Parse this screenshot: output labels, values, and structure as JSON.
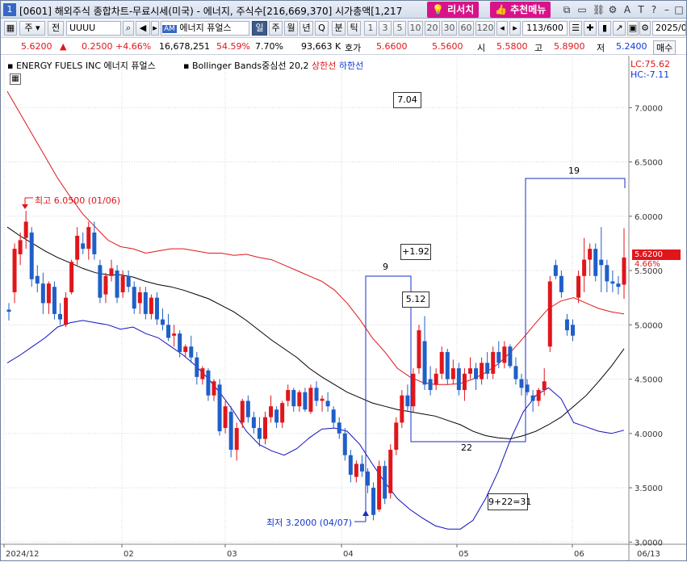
{
  "title": {
    "window_number": "1",
    "text": "[0601] 해외주식 종합차트-무료시세(미국) - 에너지, 주식수[216,669,370] 시가총액[1,217",
    "research_button": "리서치",
    "recommend_button": "추천메뉴",
    "icons": [
      "window-icon",
      "restore-icon",
      "link-icon",
      "settings-icon",
      "font-icon",
      "text-icon",
      "help-icon",
      "minimize-icon",
      "maximize-icon",
      "close-icon"
    ],
    "icon_glyphs": [
      "⧉",
      "▭",
      "⛓",
      "⚙",
      "A",
      "T",
      "?",
      "–",
      "□",
      "✕"
    ]
  },
  "toolbar": {
    "market_type": "주",
    "price_type": "전",
    "symbol": "UUUU",
    "am_badge": "AM",
    "stock_name": "에너지 퓨얼스",
    "periods": [
      "일",
      "주",
      "월",
      "년",
      "Q",
      "분",
      "틱"
    ],
    "selected_period": "일",
    "intervals": [
      "1",
      "3",
      "5",
      "10",
      "20",
      "30",
      "60",
      "120"
    ],
    "count": "113/600",
    "date": "2025/0"
  },
  "quote": {
    "price": "5.6200",
    "arrow": "▲",
    "change": "0.2500",
    "change_pct": "+4.66%",
    "volume": "16,678,251",
    "vol_ratio": "54.59%",
    "turnover": "7.70%",
    "amount": "93,663 K",
    "bid_label": "호가",
    "bid": "5.6600",
    "ask": "5.5600",
    "open_label": "시",
    "open": "5.5800",
    "high_label": "고",
    "high": "5.8900",
    "low_label": "저",
    "low": "5.2400",
    "trade_tab": "매수"
  },
  "legend": {
    "stock": "ENERGY FUELS INC  에너지 퓨얼스",
    "indicator": "Bollinger Bands중심선 20,2",
    "upper": "상한선",
    "lower": "하한선",
    "lc": "LC:75.62",
    "hc": "HC:-7.11"
  },
  "annotations": {
    "high_note": "최고 6.0500 (01/06)",
    "low_note": "최저 3.2000 (04/07)",
    "box_704": "7.04",
    "box_192": "+1.92",
    "box_512": "5.12",
    "box_sum": "9+22=31",
    "n9": "9",
    "n19": "19",
    "n22": "22"
  },
  "price_tag": {
    "price": "5.6200",
    "pct": "4.66%"
  },
  "colors": {
    "up": "#e0161b",
    "down": "#1f5fc8",
    "upper_band": "#e0161b",
    "lower_band": "#1010c0",
    "mid_band": "#000000"
  },
  "chart_data": {
    "type": "candlestick",
    "title": "ENERGY FUELS INC  에너지 퓨얼스",
    "x_ticks": [
      "2024/12",
      "02",
      "03",
      "04",
      "05",
      "06",
      "06/13"
    ],
    "y_ticks": [
      "7.0000",
      "6.5000",
      "6.0000",
      "5.5000",
      "5.0000",
      "4.5000",
      "4.0000",
      "3.5000",
      "3.0000"
    ],
    "ylim": [
      2.92,
      7.48
    ],
    "candles": [
      {
        "o": 5.14,
        "h": 5.2,
        "l": 5.04,
        "c": 5.12
      },
      {
        "o": 5.3,
        "h": 5.75,
        "l": 5.2,
        "c": 5.7
      },
      {
        "o": 5.65,
        "h": 5.85,
        "l": 5.55,
        "c": 5.78
      },
      {
        "o": 5.8,
        "h": 6.05,
        "l": 5.7,
        "c": 5.95
      },
      {
        "o": 5.85,
        "h": 5.9,
        "l": 5.35,
        "c": 5.42
      },
      {
        "o": 5.45,
        "h": 5.55,
        "l": 5.3,
        "c": 5.38
      },
      {
        "o": 5.38,
        "h": 5.48,
        "l": 5.1,
        "c": 5.2
      },
      {
        "o": 5.2,
        "h": 5.4,
        "l": 5.1,
        "c": 5.38
      },
      {
        "o": 5.35,
        "h": 5.4,
        "l": 5.05,
        "c": 5.1
      },
      {
        "o": 5.1,
        "h": 5.2,
        "l": 5.0,
        "c": 5.05
      },
      {
        "o": 5.0,
        "h": 5.3,
        "l": 4.98,
        "c": 5.25
      },
      {
        "o": 5.3,
        "h": 5.6,
        "l": 5.28,
        "c": 5.58
      },
      {
        "o": 5.6,
        "h": 5.9,
        "l": 5.55,
        "c": 5.82
      },
      {
        "o": 5.75,
        "h": 5.85,
        "l": 5.65,
        "c": 5.7
      },
      {
        "o": 5.7,
        "h": 5.95,
        "l": 5.6,
        "c": 5.9
      },
      {
        "o": 5.85,
        "h": 5.95,
        "l": 5.6,
        "c": 5.65
      },
      {
        "o": 5.55,
        "h": 5.6,
        "l": 5.2,
        "c": 5.25
      },
      {
        "o": 5.28,
        "h": 5.48,
        "l": 5.2,
        "c": 5.45
      },
      {
        "o": 5.45,
        "h": 5.6,
        "l": 5.4,
        "c": 5.52
      },
      {
        "o": 5.5,
        "h": 5.55,
        "l": 5.2,
        "c": 5.25
      },
      {
        "o": 5.3,
        "h": 5.5,
        "l": 5.25,
        "c": 5.45
      },
      {
        "o": 5.45,
        "h": 5.5,
        "l": 5.3,
        "c": 5.35
      },
      {
        "o": 5.35,
        "h": 5.4,
        "l": 5.1,
        "c": 5.15
      },
      {
        "o": 5.2,
        "h": 5.35,
        "l": 5.1,
        "c": 5.3
      },
      {
        "o": 5.3,
        "h": 5.35,
        "l": 5.05,
        "c": 5.1
      },
      {
        "o": 5.1,
        "h": 5.28,
        "l": 5.05,
        "c": 5.25
      },
      {
        "o": 5.25,
        "h": 5.3,
        "l": 5.0,
        "c": 5.05
      },
      {
        "o": 5.05,
        "h": 5.15,
        "l": 4.95,
        "c": 5.0
      },
      {
        "o": 5.0,
        "h": 5.1,
        "l": 4.85,
        "c": 4.88
      },
      {
        "o": 4.9,
        "h": 5.0,
        "l": 4.8,
        "c": 4.92
      },
      {
        "o": 4.92,
        "h": 4.95,
        "l": 4.7,
        "c": 4.75
      },
      {
        "o": 4.75,
        "h": 4.82,
        "l": 4.7,
        "c": 4.8
      },
      {
        "o": 4.8,
        "h": 4.9,
        "l": 4.65,
        "c": 4.7
      },
      {
        "o": 4.7,
        "h": 4.75,
        "l": 4.45,
        "c": 4.52
      },
      {
        "o": 4.5,
        "h": 4.62,
        "l": 4.45,
        "c": 4.6
      },
      {
        "o": 4.58,
        "h": 4.6,
        "l": 4.3,
        "c": 4.35
      },
      {
        "o": 4.35,
        "h": 4.5,
        "l": 4.3,
        "c": 4.48
      },
      {
        "o": 4.45,
        "h": 4.5,
        "l": 3.98,
        "c": 4.02
      },
      {
        "o": 4.05,
        "h": 4.3,
        "l": 4.0,
        "c": 4.25
      },
      {
        "o": 4.2,
        "h": 4.25,
        "l": 3.78,
        "c": 3.85
      },
      {
        "o": 3.85,
        "h": 4.1,
        "l": 3.75,
        "c": 4.05
      },
      {
        "o": 4.1,
        "h": 4.32,
        "l": 4.05,
        "c": 4.3
      },
      {
        "o": 4.3,
        "h": 4.35,
        "l": 4.1,
        "c": 4.15
      },
      {
        "o": 4.15,
        "h": 4.2,
        "l": 4.0,
        "c": 4.05
      },
      {
        "o": 4.05,
        "h": 4.15,
        "l": 3.88,
        "c": 3.95
      },
      {
        "o": 3.95,
        "h": 4.2,
        "l": 3.9,
        "c": 4.15
      },
      {
        "o": 4.15,
        "h": 4.35,
        "l": 4.1,
        "c": 4.25
      },
      {
        "o": 4.22,
        "h": 4.25,
        "l": 4.05,
        "c": 4.1
      },
      {
        "o": 4.1,
        "h": 4.3,
        "l": 4.05,
        "c": 4.28
      },
      {
        "o": 4.3,
        "h": 4.45,
        "l": 4.25,
        "c": 4.4
      },
      {
        "o": 4.4,
        "h": 4.42,
        "l": 4.2,
        "c": 4.25
      },
      {
        "o": 4.25,
        "h": 4.4,
        "l": 4.2,
        "c": 4.38
      },
      {
        "o": 4.38,
        "h": 4.42,
        "l": 4.2,
        "c": 4.22
      },
      {
        "o": 4.2,
        "h": 4.45,
        "l": 4.18,
        "c": 4.42
      },
      {
        "o": 4.42,
        "h": 4.48,
        "l": 4.25,
        "c": 4.3
      },
      {
        "o": 4.3,
        "h": 4.35,
        "l": 4.2,
        "c": 4.32
      },
      {
        "o": 4.3,
        "h": 4.38,
        "l": 4.2,
        "c": 4.25
      },
      {
        "o": 4.22,
        "h": 4.25,
        "l": 4.05,
        "c": 4.1
      },
      {
        "o": 4.1,
        "h": 4.15,
        "l": 3.95,
        "c": 4.0
      },
      {
        "o": 4.0,
        "h": 4.05,
        "l": 3.75,
        "c": 3.8
      },
      {
        "o": 3.8,
        "h": 3.85,
        "l": 3.55,
        "c": 3.62
      },
      {
        "o": 3.6,
        "h": 3.75,
        "l": 3.55,
        "c": 3.72
      },
      {
        "o": 3.72,
        "h": 3.8,
        "l": 3.6,
        "c": 3.65
      },
      {
        "o": 3.65,
        "h": 3.68,
        "l": 3.45,
        "c": 3.52
      },
      {
        "o": 3.5,
        "h": 3.55,
        "l": 3.2,
        "c": 3.25
      },
      {
        "o": 3.3,
        "h": 3.75,
        "l": 3.28,
        "c": 3.7
      },
      {
        "o": 3.7,
        "h": 3.75,
        "l": 3.35,
        "c": 3.4
      },
      {
        "o": 3.45,
        "h": 3.9,
        "l": 3.4,
        "c": 3.85
      },
      {
        "o": 3.85,
        "h": 4.15,
        "l": 3.8,
        "c": 4.1
      },
      {
        "o": 4.1,
        "h": 4.4,
        "l": 4.05,
        "c": 4.35
      },
      {
        "o": 4.35,
        "h": 4.45,
        "l": 4.2,
        "c": 4.25
      },
      {
        "o": 4.25,
        "h": 4.6,
        "l": 4.2,
        "c": 4.55
      },
      {
        "o": 4.6,
        "h": 5.0,
        "l": 4.55,
        "c": 4.95
      },
      {
        "o": 4.85,
        "h": 5.08,
        "l": 4.4,
        "c": 4.45
      },
      {
        "o": 4.5,
        "h": 4.62,
        "l": 4.35,
        "c": 4.4
      },
      {
        "o": 4.45,
        "h": 4.6,
        "l": 4.4,
        "c": 4.55
      },
      {
        "o": 4.55,
        "h": 4.8,
        "l": 4.5,
        "c": 4.75
      },
      {
        "o": 4.75,
        "h": 4.78,
        "l": 4.45,
        "c": 4.5
      },
      {
        "o": 4.5,
        "h": 4.68,
        "l": 4.45,
        "c": 4.6
      },
      {
        "o": 4.6,
        "h": 4.65,
        "l": 4.35,
        "c": 4.4
      },
      {
        "o": 4.4,
        "h": 4.6,
        "l": 4.3,
        "c": 4.55
      },
      {
        "o": 4.55,
        "h": 4.7,
        "l": 4.5,
        "c": 4.6
      },
      {
        "o": 4.6,
        "h": 4.65,
        "l": 4.4,
        "c": 4.5
      },
      {
        "o": 4.5,
        "h": 4.7,
        "l": 4.45,
        "c": 4.65
      },
      {
        "o": 4.65,
        "h": 4.75,
        "l": 4.5,
        "c": 4.55
      },
      {
        "o": 4.55,
        "h": 4.8,
        "l": 4.5,
        "c": 4.75
      },
      {
        "o": 4.75,
        "h": 4.85,
        "l": 4.6,
        "c": 4.65
      },
      {
        "o": 4.65,
        "h": 4.85,
        "l": 4.6,
        "c": 4.8
      },
      {
        "o": 4.8,
        "h": 4.82,
        "l": 4.6,
        "c": 4.62
      },
      {
        "o": 4.62,
        "h": 4.7,
        "l": 4.45,
        "c": 4.5
      },
      {
        "o": 4.5,
        "h": 4.55,
        "l": 4.35,
        "c": 4.42
      },
      {
        "o": 4.45,
        "h": 4.5,
        "l": 4.35,
        "c": 4.38
      },
      {
        "o": 4.35,
        "h": 4.4,
        "l": 4.2,
        "c": 4.3
      },
      {
        "o": 4.3,
        "h": 4.42,
        "l": 4.25,
        "c": 4.4
      },
      {
        "o": 4.4,
        "h": 4.6,
        "l": 4.35,
        "c": 4.48
      },
      {
        "o": 4.8,
        "h": 5.45,
        "l": 4.75,
        "c": 5.4
      },
      {
        "o": 5.55,
        "h": 5.6,
        "l": 5.42,
        "c": 5.45
      },
      {
        "o": 5.45,
        "h": 5.5,
        "l": 5.25,
        "c": 5.3
      },
      {
        "o": 5.05,
        "h": 5.1,
        "l": 4.9,
        "c": 4.95
      },
      {
        "o": 5.0,
        "h": 5.05,
        "l": 4.85,
        "c": 4.9
      },
      {
        "o": 5.25,
        "h": 5.5,
        "l": 5.2,
        "c": 5.45
      },
      {
        "o": 5.45,
        "h": 5.8,
        "l": 5.3,
        "c": 5.6
      },
      {
        "o": 5.6,
        "h": 5.75,
        "l": 5.45,
        "c": 5.7
      },
      {
        "o": 5.7,
        "h": 5.75,
        "l": 5.4,
        "c": 5.45
      },
      {
        "o": 5.6,
        "h": 5.9,
        "l": 5.3,
        "c": 5.55
      },
      {
        "o": 5.55,
        "h": 5.6,
        "l": 5.3,
        "c": 5.4
      },
      {
        "o": 5.4,
        "h": 5.5,
        "l": 5.3,
        "c": 5.38
      },
      {
        "o": 5.38,
        "h": 5.45,
        "l": 5.28,
        "c": 5.35
      },
      {
        "o": 5.37,
        "h": 5.89,
        "l": 5.24,
        "c": 5.62
      }
    ],
    "bands": {
      "upper": [
        7.15,
        6.95,
        6.75,
        6.55,
        6.35,
        6.18,
        6.02,
        5.9,
        5.78,
        5.72,
        5.7,
        5.66,
        5.68,
        5.7,
        5.7,
        5.68,
        5.66,
        5.66,
        5.64,
        5.65,
        5.62,
        5.6,
        5.55,
        5.5,
        5.45,
        5.4,
        5.32,
        5.2,
        5.05,
        4.88,
        4.75,
        4.6,
        4.52,
        4.47,
        4.45,
        4.45,
        4.46,
        4.5,
        4.56,
        4.64,
        4.75,
        4.88,
        5.02,
        5.15,
        5.22,
        5.25,
        5.2,
        5.15,
        5.12,
        5.1
      ],
      "middle": [
        5.9,
        5.82,
        5.75,
        5.68,
        5.62,
        5.57,
        5.52,
        5.48,
        5.46,
        5.46,
        5.44,
        5.4,
        5.37,
        5.35,
        5.32,
        5.28,
        5.24,
        5.18,
        5.12,
        5.04,
        4.95,
        4.86,
        4.78,
        4.7,
        4.6,
        4.52,
        4.45,
        4.38,
        4.33,
        4.28,
        4.25,
        4.22,
        4.2,
        4.18,
        4.16,
        4.12,
        4.08,
        4.02,
        3.98,
        3.96,
        3.95,
        3.98,
        4.02,
        4.08,
        4.15,
        4.25,
        4.35,
        4.48,
        4.62,
        4.78
      ],
      "lower": [
        4.65,
        4.72,
        4.8,
        4.88,
        4.98,
        5.02,
        5.04,
        5.02,
        5.0,
        4.96,
        4.98,
        4.92,
        4.88,
        4.8,
        4.72,
        4.62,
        4.5,
        4.36,
        4.2,
        4.02,
        3.9,
        3.84,
        3.8,
        3.86,
        3.96,
        4.04,
        4.05,
        4.02,
        3.9,
        3.72,
        3.55,
        3.4,
        3.3,
        3.22,
        3.15,
        3.12,
        3.12,
        3.2,
        3.4,
        3.65,
        3.95,
        4.2,
        4.35,
        4.42,
        4.32,
        4.1,
        4.06,
        4.02,
        4.0,
        4.03
      ]
    }
  }
}
